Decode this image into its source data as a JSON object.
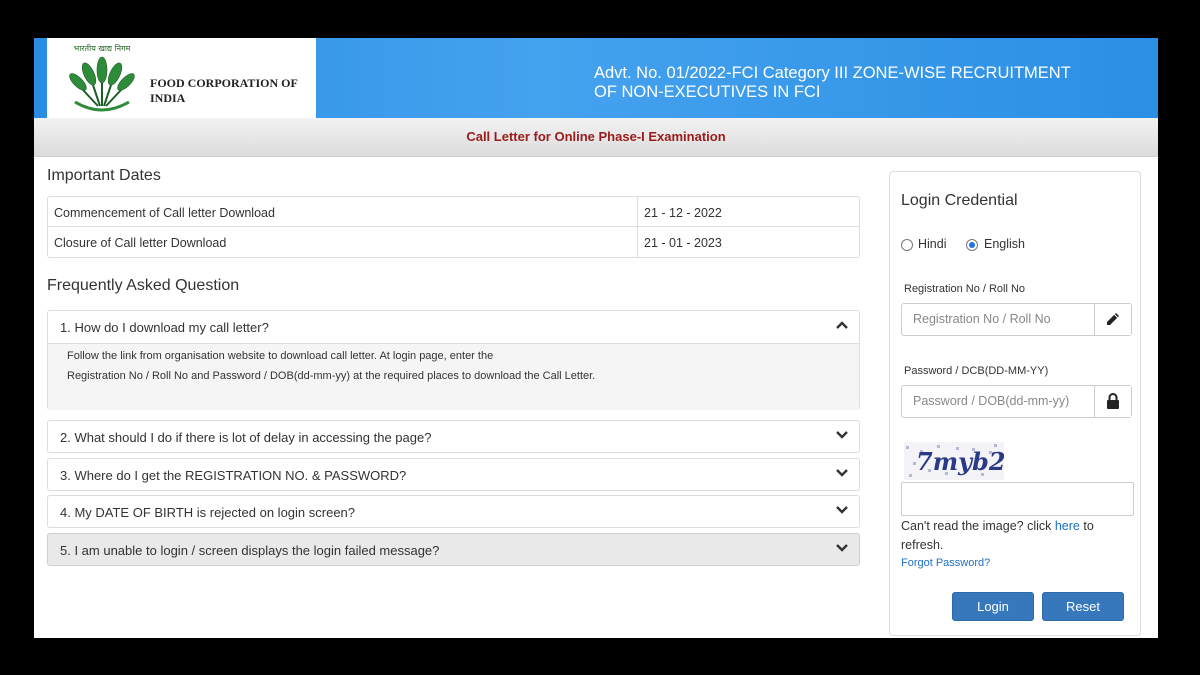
{
  "header": {
    "emblem_motto": "भारतीय खाद्य निगम",
    "org_name": "FOOD CORPORATION OF INDIA",
    "title_line1": "Advt. No. 01/2022-FCI Category III ZONE-WISE RECRUITMENT",
    "title_line2": "OF NON-EXECUTIVES IN FCI"
  },
  "subheader": {
    "title": "Call Letter for Online Phase-I Examination"
  },
  "important_dates": {
    "heading": "Important Dates",
    "rows": [
      {
        "label": "Commencement of Call letter Download",
        "value": "21 - 12 - 2022"
      },
      {
        "label": "Closure of Call letter Download",
        "value": "21 - 01 - 2023"
      }
    ]
  },
  "faq": {
    "heading": "Frequently Asked Question",
    "items": [
      {
        "question": "1. How do I download my call letter?",
        "expanded": true,
        "answer_line1": "Follow the link from organisation website to download call letter. At login page, enter the",
        "answer_line2": "Registration No / Roll No and Password / DOB(dd-mm-yy) at the required places to download the Call Letter."
      },
      {
        "question": "2. What should I do if there is lot of delay in accessing the page?",
        "expanded": false
      },
      {
        "question": "3. Where do I get the REGISTRATION NO. & PASSWORD?",
        "expanded": false
      },
      {
        "question": "4. My DATE OF BIRTH is rejected on login screen?",
        "expanded": false
      },
      {
        "question": "5. I am unable to login / screen displays the login failed message?",
        "expanded": false
      }
    ]
  },
  "login": {
    "title": "Login Credential",
    "languages": [
      {
        "label": "Hindi",
        "selected": false
      },
      {
        "label": "English",
        "selected": true
      }
    ],
    "registration_label": "Registration No / Roll No",
    "registration_placeholder": "Registration No / Roll No",
    "registration_icon": "pencil-icon",
    "password_label": "Password / DCB(DD-MM-YY)",
    "password_placeholder": "Password / DOB(dd-mm-yy)",
    "password_icon": "lock-icon",
    "captcha_text": "7myb2",
    "captcha_help_prefix": "Can't read the image? click ",
    "captcha_help_link": "here",
    "captcha_help_suffix": " to refresh.",
    "forgot_password": "Forgot Password?",
    "login_button": "Login",
    "reset_button": "Reset"
  },
  "colors": {
    "header_blue": "#2b8fe4",
    "subheader_text": "#9b1b1b",
    "button_blue": "#3778bd",
    "link_blue": "#1f6fc4"
  }
}
